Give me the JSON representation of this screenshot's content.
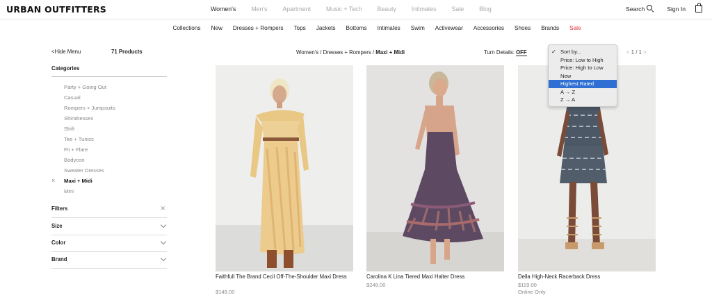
{
  "header": {
    "logo": "URBAN OUTFITTERS",
    "primary_nav": [
      "Women's",
      "Men's",
      "Apartment",
      "Music + Tech",
      "Beauty",
      "Intimates",
      "Sale",
      "Blog"
    ],
    "search_label": "Search",
    "signin_label": "Sign In"
  },
  "category_nav": [
    "Collections",
    "New",
    "Dresses + Rompers",
    "Tops",
    "Jackets",
    "Bottoms",
    "Intimates",
    "Swim",
    "Activewear",
    "Accessories",
    "Shoes",
    "Brands",
    "Sale"
  ],
  "sidebar": {
    "hide_menu_label": "Hide Menu",
    "product_count": "71 Products",
    "categories_heading": "Categories",
    "categories": [
      "Party + Going Out",
      "Casual",
      "Rompers + Jumpsuits",
      "Shirtdresses",
      "Shift",
      "Tee + Tunics",
      "Fit + Flare",
      "Bodycon",
      "Sweater Dresses",
      "Maxi + Midi",
      "Mini"
    ],
    "selected_category": "Maxi + Midi",
    "filters_label": "Filters",
    "filter_groups": [
      "Size",
      "Color",
      "Brand"
    ]
  },
  "toolbar": {
    "breadcrumb_prefix": "Women's / Dresses + Rompers / ",
    "breadcrumb_current": "Maxi + Midi",
    "turn_details_label": "Turn Details:",
    "turn_details_value": "OFF",
    "page_current": "1",
    "page_total": "1"
  },
  "sort_menu": {
    "options": [
      "Sort by...",
      "Price: Low to High",
      "Price: High to Low",
      "New",
      "Highest Rated",
      "A → Z",
      "Z → A"
    ],
    "checked": "Sort by...",
    "highlighted": "Highest Rated"
  },
  "products": [
    {
      "name": "Faithfull The Brand Cecil Off-The-Shoulder Maxi Dress",
      "price": "$149.00",
      "note": ""
    },
    {
      "name": "Carolina K Lina Tiered Maxi Halter Dress",
      "price": "$249.00",
      "note": ""
    },
    {
      "name": "Della High-Neck Racerback Dress",
      "price": "$119.00",
      "note": "Online Only"
    }
  ],
  "colors": {
    "sale_red": "#dd3333",
    "menu_highlight": "#2f6fd3"
  }
}
